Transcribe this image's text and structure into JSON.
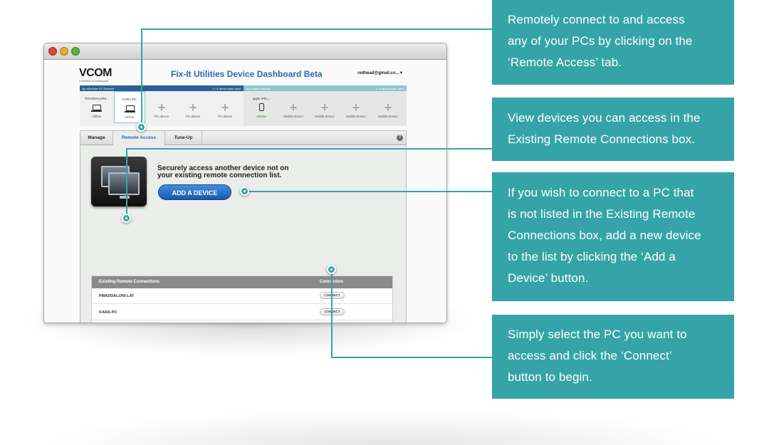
{
  "window": {
    "logo": "VCOM",
    "logo_sub": "A division of Avanquest",
    "title": "Fix-It Utilities Device Dashboard Beta",
    "account": "redhead@gmail.co...▼"
  },
  "pc_devices": {
    "header": "My Windows PC Devices",
    "slots": "2 / 5 device slots used",
    "items": [
      {
        "name": "PMADDALONI...",
        "status": "Offline"
      },
      {
        "name": "KARA-PC",
        "status": "Online"
      },
      {
        "name": "",
        "status": "PC device"
      },
      {
        "name": "",
        "status": "PC device"
      },
      {
        "name": "",
        "status": "PC device"
      }
    ]
  },
  "mobile_devices": {
    "header": "My Mobile Devices",
    "slots": "1 / 5 device slots used",
    "items": [
      {
        "name": "apple iPho...",
        "status": "Active"
      },
      {
        "name": "",
        "status": "Mobile device"
      },
      {
        "name": "",
        "status": "Mobile device"
      },
      {
        "name": "",
        "status": "Mobile device"
      },
      {
        "name": "",
        "status": "Mobile device"
      }
    ]
  },
  "tabs": [
    "Manage",
    "Remote Access",
    "Tune-Up"
  ],
  "help_label": "?",
  "remote": {
    "line1": "Securely access another device not on",
    "line2": "your existing remote connection list.",
    "add_button": "ADD A DEVICE",
    "table": {
      "col_name": "Existing Remote Connections",
      "col_connection": "Connection",
      "rows": [
        {
          "pc": "PMADDALONI-LAT",
          "action": "CONNECT"
        },
        {
          "pc": "KARA-PC",
          "action": "CONNECT"
        }
      ]
    }
  },
  "callouts": [
    [
      "Remotely connect to and access",
      "any of your PCs by clicking on the",
      "‘Remote Access’ tab."
    ],
    [
      "View devices you can access in the",
      "Existing Remote Connections box."
    ],
    [
      "If you wish to connect to a PC that",
      "is not listed in the Existing Remote",
      "Connections box, add a new device",
      "to the list by clicking the ‘Add a",
      "Device’ button."
    ],
    [
      "Simply select the PC you want to",
      "access and click the ‘Connect’",
      "button to begin."
    ]
  ],
  "colors": {
    "callout_bg": "#35a4a8",
    "accent_blue": "#2d66b4",
    "pc_header": "#2a5f97",
    "mobile_header": "#8ec6cf"
  }
}
